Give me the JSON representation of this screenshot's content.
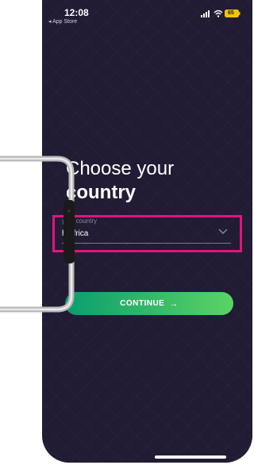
{
  "status_bar": {
    "time": "12:08",
    "back_app": "◂ App Store",
    "battery": "65"
  },
  "headline": {
    "line1": "Choose your",
    "line2": "country"
  },
  "country_field": {
    "label": "your country",
    "value": "h Africa"
  },
  "continue_button": {
    "label": "CONTINUE",
    "arrow": "→"
  },
  "colors": {
    "background": "#211b34",
    "accent_start": "#0a9d6f",
    "accent_end": "#5cd364",
    "highlight": "#e6127d"
  },
  "icons": [
    "signal-icon",
    "wifi-icon",
    "battery-icon",
    "chevron-down-icon",
    "arrow-right-icon"
  ]
}
